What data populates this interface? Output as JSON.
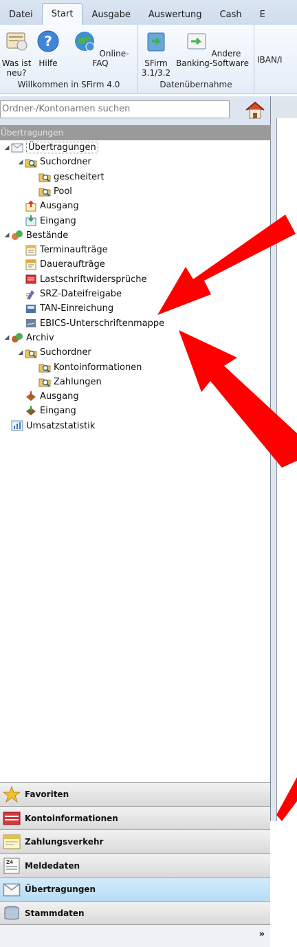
{
  "tabs": [
    "Datei",
    "Start",
    "Ausgabe",
    "Auswertung",
    "Cash",
    "E"
  ],
  "active_tab": 1,
  "ribbon": {
    "welcome": {
      "title": "Willkommen in SFirm 4.0",
      "buttons": [
        "Was ist neu?",
        "Hilfe",
        "Online-FAQ"
      ]
    },
    "import": {
      "title": "Datenübernahme",
      "buttons": [
        "SFirm 3.1/3.2",
        "Andere Banking-Software"
      ]
    },
    "partial": "IBAN/I"
  },
  "search": {
    "placeholder": "Ordner-/Kontonamen suchen"
  },
  "pane_header": "Übertragungen",
  "tree": [
    {
      "label": "Übertragungen",
      "icon": "envelope-icon",
      "level": 0,
      "expanded": true,
      "selected": true
    },
    {
      "label": "Suchordner",
      "icon": "search-folder-icon",
      "level": 1,
      "expanded": true
    },
    {
      "label": "gescheitert",
      "icon": "search-folder-icon",
      "level": 2
    },
    {
      "label": "Pool",
      "icon": "search-folder-icon",
      "level": 2
    },
    {
      "label": "Ausgang",
      "icon": "outbox-icon",
      "level": 1
    },
    {
      "label": "Eingang",
      "icon": "inbox-icon",
      "level": 1
    },
    {
      "label": "Bestände",
      "icon": "stock-icon",
      "level": 0,
      "expanded": true
    },
    {
      "label": "Terminaufträge",
      "icon": "calendar-icon",
      "level": 1
    },
    {
      "label": "Daueraufträge",
      "icon": "standing-order-icon",
      "level": 1
    },
    {
      "label": "Lastschriftwidersprüche",
      "icon": "debit-objection-icon",
      "level": 1
    },
    {
      "label": "SRZ-Dateifreigabe",
      "icon": "file-release-icon",
      "level": 1
    },
    {
      "label": "TAN-Einreichung",
      "icon": "tan-icon",
      "level": 1
    },
    {
      "label": "EBICS-Unterschriftenmappe",
      "icon": "signature-folder-icon",
      "level": 1
    },
    {
      "label": "Archiv",
      "icon": "archive-icon",
      "level": 0,
      "expanded": true
    },
    {
      "label": "Suchordner",
      "icon": "search-folder-icon",
      "level": 1,
      "expanded": true
    },
    {
      "label": "Kontoinformationen",
      "icon": "search-folder-icon",
      "level": 2
    },
    {
      "label": "Zahlungen",
      "icon": "search-folder-icon",
      "level": 2
    },
    {
      "label": "Ausgang",
      "icon": "archive-outbox-icon",
      "level": 1
    },
    {
      "label": "Eingang",
      "icon": "archive-inbox-icon",
      "level": 1
    },
    {
      "label": "Umsatzstatistik",
      "icon": "statistics-icon",
      "level": 0
    }
  ],
  "nav": [
    {
      "label": "Favoriten",
      "icon": "star-icon"
    },
    {
      "label": "Kontoinformationen",
      "icon": "account-info-icon"
    },
    {
      "label": "Zahlungsverkehr",
      "icon": "payments-icon"
    },
    {
      "label": "Meldedaten",
      "icon": "report-data-icon"
    },
    {
      "label": "Übertragungen",
      "icon": "envelope-icon",
      "active": true
    },
    {
      "label": "Stammdaten",
      "icon": "master-data-icon"
    }
  ],
  "nav_more": "»",
  "colors": {
    "arrow": "#ff0000",
    "active_nav": "#bfe0f5",
    "header": "#9a9a9a"
  }
}
